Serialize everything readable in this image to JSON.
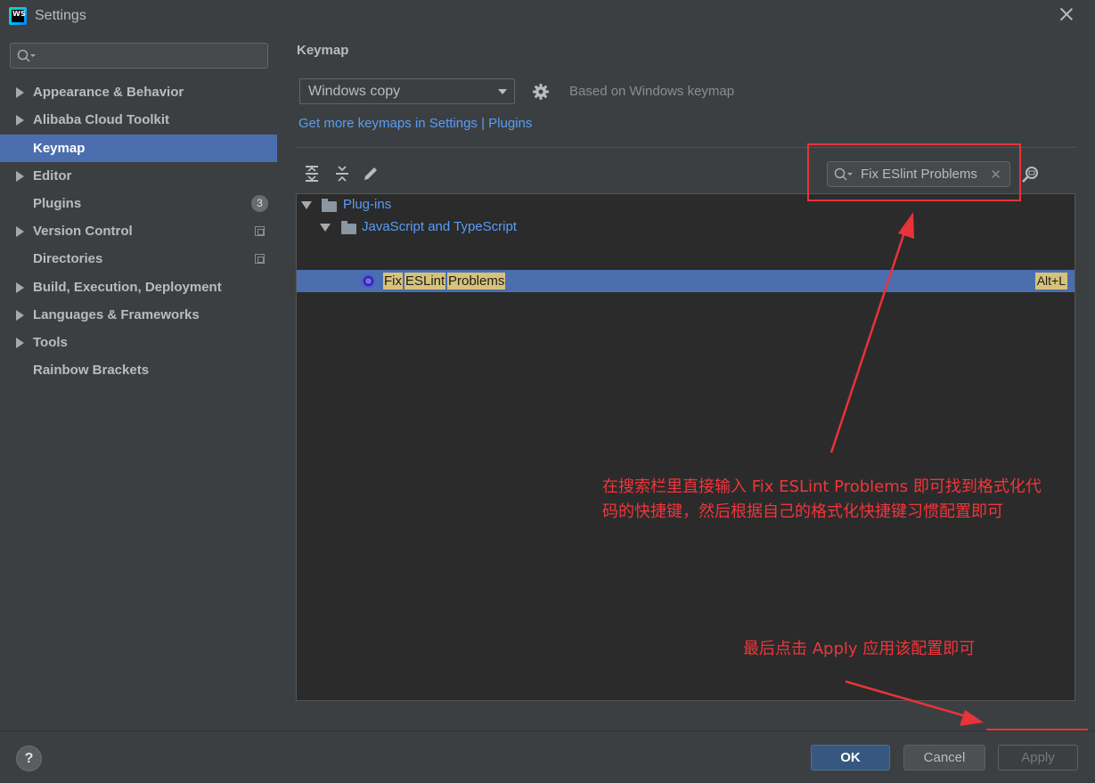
{
  "window": {
    "title": "Settings",
    "app_icon_text": "WS"
  },
  "sidebar": {
    "search_placeholder": "",
    "items": [
      {
        "label": "Appearance & Behavior",
        "expandable": true
      },
      {
        "label": "Alibaba Cloud Toolkit",
        "expandable": true
      },
      {
        "label": "Keymap",
        "expandable": false,
        "selected": true
      },
      {
        "label": "Editor",
        "expandable": true
      },
      {
        "label": "Plugins",
        "expandable": false,
        "badge": "3"
      },
      {
        "label": "Version Control",
        "expandable": true
      },
      {
        "label": "Directories",
        "expandable": false
      },
      {
        "label": "Build, Execution, Deployment",
        "expandable": true
      },
      {
        "label": "Languages & Frameworks",
        "expandable": true
      },
      {
        "label": "Tools",
        "expandable": true
      },
      {
        "label": "Rainbow Brackets",
        "expandable": false
      }
    ]
  },
  "main": {
    "title": "Keymap",
    "keymap_select": "Windows copy",
    "based_on": "Based on Windows keymap",
    "more_link": "Get more keymaps in Settings | Plugins",
    "filter_value": "Fix ESlint Problems",
    "tree": {
      "root": "Plug-ins",
      "group": "JavaScript and TypeScript",
      "action_words": [
        "Fix",
        "ESLint",
        "Problems"
      ],
      "action_shortcut": "Alt+L"
    }
  },
  "annotations": {
    "note1_line1": "在搜索栏里直接输入 Fix ESLint Problems 即可找到格式化代",
    "note1_line2": "码的快捷键，然后根据自己的格式化快捷键习惯配置即可",
    "note2": "最后点击 Apply 应用该配置即可",
    "color": "#f0353b"
  },
  "buttons": {
    "help": "?",
    "ok": "OK",
    "cancel": "Cancel",
    "apply": "Apply"
  },
  "colors": {
    "background": "#3c3f41",
    "selection": "#4b6eaf",
    "link": "#589df6",
    "match_highlight": "#d7c27a"
  }
}
